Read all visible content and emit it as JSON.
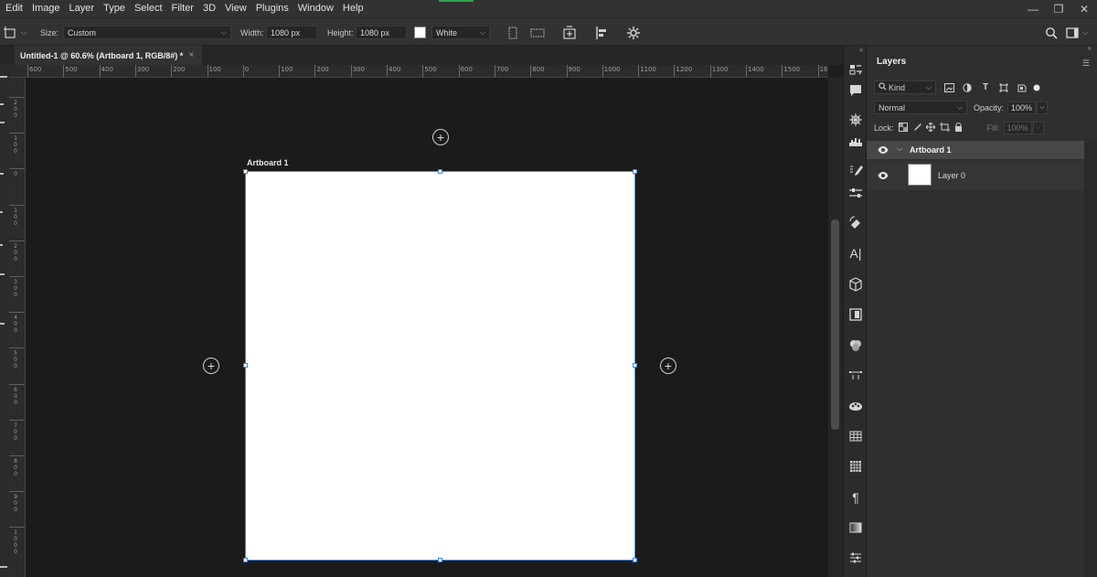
{
  "menu": {
    "items": [
      "Edit",
      "Image",
      "Layer",
      "Type",
      "Select",
      "Filter",
      "3D",
      "View",
      "Plugins",
      "Window",
      "Help"
    ]
  },
  "window_controls": {
    "minimize": "—",
    "restore": "❐",
    "close": "✕"
  },
  "options_bar": {
    "size_label": "Size:",
    "size_value": "Custom",
    "width_label": "Width:",
    "width_value": "1080 px",
    "height_label": "Height:",
    "height_value": "1080 px",
    "background_value": "White",
    "background_swatch": "#ffffff"
  },
  "document": {
    "tab_title": "Untitled-1 @ 60.6% (Artboard 1, RGB/8#) *",
    "close": "×"
  },
  "ruler_top": [
    "600",
    "500",
    "400",
    "300",
    "200",
    "100",
    "0",
    "100",
    "200",
    "300",
    "400",
    "500",
    "600",
    "700",
    "800",
    "900",
    "1000",
    "1100",
    "1200",
    "1300",
    "1400",
    "1500",
    "16"
  ],
  "ruler_left": [
    "200",
    "100",
    "0",
    "100",
    "200",
    "300",
    "400",
    "500",
    "600",
    "700",
    "800",
    "900",
    "1000"
  ],
  "canvas": {
    "artboard_label": "Artboard 1",
    "artboard_color": "#ffffff",
    "selection_color": "#4a90e2"
  },
  "layers_panel": {
    "title": "Layers",
    "kind_filter": "Kind",
    "blend_mode": "Normal",
    "opacity_label": "Opacity:",
    "opacity_value": "100%",
    "lock_label": "Lock:",
    "fill_label": "Fill:",
    "fill_value": "100%",
    "layers": [
      {
        "name": "Artboard 1",
        "type": "artboard"
      },
      {
        "name": "Layer 0",
        "type": "pixel"
      }
    ]
  }
}
